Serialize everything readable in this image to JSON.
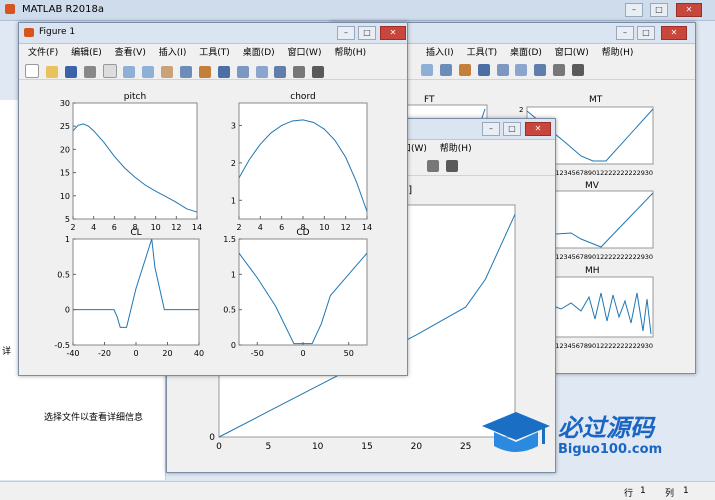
{
  "app": {
    "title": "MATLAB R2018a",
    "left_hint": "选择文件以查看详细信息",
    "left_label": "详"
  },
  "status": {
    "row_label": "行",
    "row_value": "1",
    "col_label": "列",
    "col_value": "1"
  },
  "logo": {
    "cn": "必过源码",
    "en": "Biguo100.com"
  },
  "figure1": {
    "title": "Figure 1",
    "menu": [
      "文件(F)",
      "编辑(E)",
      "查看(V)",
      "插入(I)",
      "工具(T)",
      "桌面(D)",
      "窗口(W)",
      "帮助(H)"
    ]
  },
  "figure_right": {
    "menu": [
      "插入(I)",
      "工具(T)",
      "桌面(D)",
      "窗口(W)",
      "帮助(H)"
    ]
  },
  "figure_mid": {
    "menu": [
      "口(W)",
      "帮助(H)"
    ],
    "partial_title": "s]"
  },
  "chart_data": [
    {
      "type": "line",
      "title": "pitch",
      "xlim": [
        2,
        14
      ],
      "ylim": [
        5,
        30
      ],
      "xticks": [
        "2",
        "4",
        "6",
        "8",
        "10",
        "12",
        "14"
      ],
      "yticks": [
        "5",
        "10",
        "15",
        "20",
        "25",
        "30"
      ],
      "x": [
        2,
        2.5,
        3,
        3.5,
        4,
        5,
        6,
        7,
        8,
        9,
        10,
        11,
        12,
        13,
        14
      ],
      "y": [
        24,
        25.2,
        25.5,
        25,
        24,
        21.5,
        18.5,
        16,
        14,
        12.3,
        11,
        9.8,
        8.6,
        7.2,
        6.5
      ]
    },
    {
      "type": "line",
      "title": "chord",
      "xlim": [
        2,
        14
      ],
      "ylim": [
        0.5,
        3.6
      ],
      "xticks": [
        "2",
        "4",
        "6",
        "8",
        "10",
        "12",
        "14"
      ],
      "yticks": [
        "1",
        "2",
        "3"
      ],
      "x": [
        2,
        3,
        4,
        5,
        6,
        7,
        8,
        9,
        10,
        11,
        12,
        13,
        14
      ],
      "y": [
        1.6,
        2.1,
        2.5,
        2.8,
        3.0,
        3.12,
        3.15,
        3.08,
        2.9,
        2.6,
        2.15,
        1.5,
        0.7
      ]
    },
    {
      "type": "line",
      "title": "CL",
      "xlim": [
        -40,
        40
      ],
      "ylim": [
        -0.5,
        1
      ],
      "xticks": [
        "-40",
        "-20",
        "0",
        "20",
        "40"
      ],
      "yticks": [
        "-0.5",
        "0",
        "0.5",
        "1"
      ],
      "x": [
        -40,
        -14,
        -12,
        -10,
        -6,
        0,
        10,
        12,
        18,
        25,
        40
      ],
      "y": [
        0,
        0,
        -0.1,
        -0.25,
        -0.25,
        0.3,
        1,
        0.6,
        0,
        0,
        0
      ]
    },
    {
      "type": "line",
      "title": "CD",
      "xlim": [
        -70,
        70
      ],
      "ylim": [
        0,
        1.5
      ],
      "xticks": [
        "-50",
        "0",
        "50"
      ],
      "yticks": [
        "0",
        "0.5",
        "1",
        "1.5"
      ],
      "x": [
        -70,
        -50,
        -30,
        -10,
        10,
        20,
        30,
        50,
        70
      ],
      "y": [
        1.3,
        0.95,
        0.55,
        0.02,
        0.02,
        0.3,
        0.7,
        1.0,
        1.3
      ]
    },
    {
      "type": "line",
      "title": "",
      "xlim": [
        0,
        30
      ],
      "ylim": [
        0,
        5
      ],
      "xticks": [
        "0",
        "5",
        "10",
        "15",
        "20",
        "25",
        "30"
      ],
      "yticks": [
        "0",
        "5"
      ],
      "x": [
        0,
        5,
        10,
        15,
        20,
        25,
        27,
        30
      ],
      "y": [
        0,
        0.55,
        1.1,
        1.65,
        2.2,
        2.8,
        3.4,
        4.8
      ]
    },
    {
      "type": "line",
      "title": "FT",
      "x": [
        0,
        1
      ],
      "y": [
        0,
        1
      ]
    },
    {
      "type": "line",
      "title": "MT",
      "yticks": [
        "2"
      ],
      "xticklabels": "7891011123456789012222222222930"
    },
    {
      "type": "line",
      "title": "MV",
      "xticklabels": "7891011123456789012222222222930"
    },
    {
      "type": "line",
      "title": "MH",
      "xticklabels": "7891011123456789012222222222930"
    }
  ]
}
